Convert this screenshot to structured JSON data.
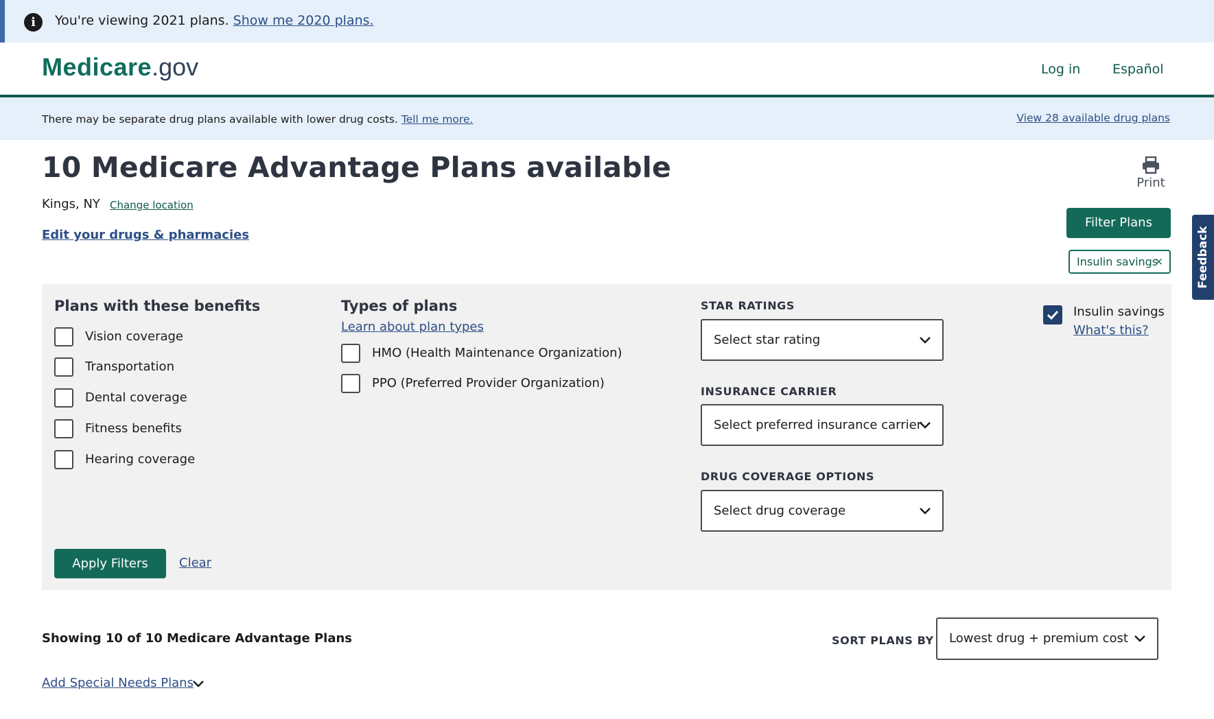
{
  "info_banner": {
    "icon": "info-icon",
    "text": "You're viewing 2021 plans.",
    "link": "Show me 2020 plans."
  },
  "header": {
    "logo_main": "Medicare",
    "logo_suffix": ".gov",
    "login": "Log in",
    "language": "Español"
  },
  "drug_notice": {
    "text": "There may be separate drug plans available with lower drug costs.",
    "link": "Tell me more.",
    "right_link": "View 28 available drug plans"
  },
  "page": {
    "title": "10 Medicare Advantage Plans available",
    "location": "Kings, NY",
    "change_location": "Change location",
    "edit_drugs": "Edit your drugs & pharmacies",
    "print": "Print",
    "filter_plans": "Filter Plans",
    "active_filter_chip": "Insulin savings",
    "chip_close": "×",
    "feedback": "Feedback"
  },
  "filters": {
    "benefits_heading": "Plans with these benefits",
    "benefits": [
      {
        "label": "Vision coverage",
        "checked": false
      },
      {
        "label": "Transportation",
        "checked": false
      },
      {
        "label": "Dental coverage",
        "checked": false
      },
      {
        "label": "Fitness benefits",
        "checked": false
      },
      {
        "label": "Hearing coverage",
        "checked": false
      }
    ],
    "types_heading": "Types of plans",
    "types_link": "Learn about plan types",
    "types": [
      {
        "label": "HMO (Health Maintenance Organization)",
        "checked": false
      },
      {
        "label": "PPO (Preferred Provider Organization)",
        "checked": false
      }
    ],
    "star_label": "STAR RATINGS",
    "star_value": "Select star rating",
    "carrier_label": "INSURANCE CARRIER",
    "carrier_value": "Select preferred insurance carrier",
    "drug_label": "DRUG COVERAGE OPTIONS",
    "drug_value": "Select drug coverage",
    "insulin": {
      "label": "Insulin savings",
      "checked": true,
      "link": "What's this?"
    },
    "apply": "Apply Filters",
    "clear": "Clear"
  },
  "results": {
    "showing": "Showing 10 of 10 Medicare Advantage Plans",
    "sort_label": "SORT PLANS BY",
    "sort_value": "Lowest drug + premium cost",
    "add_snp": "Add Special Needs Plans"
  },
  "colors": {
    "primary_green": "#136a58",
    "link_blue": "#2c4e86",
    "banner_bg": "#e6f0fa",
    "panel_bg": "#f1f1f1",
    "feedback_navy": "#21406d"
  }
}
